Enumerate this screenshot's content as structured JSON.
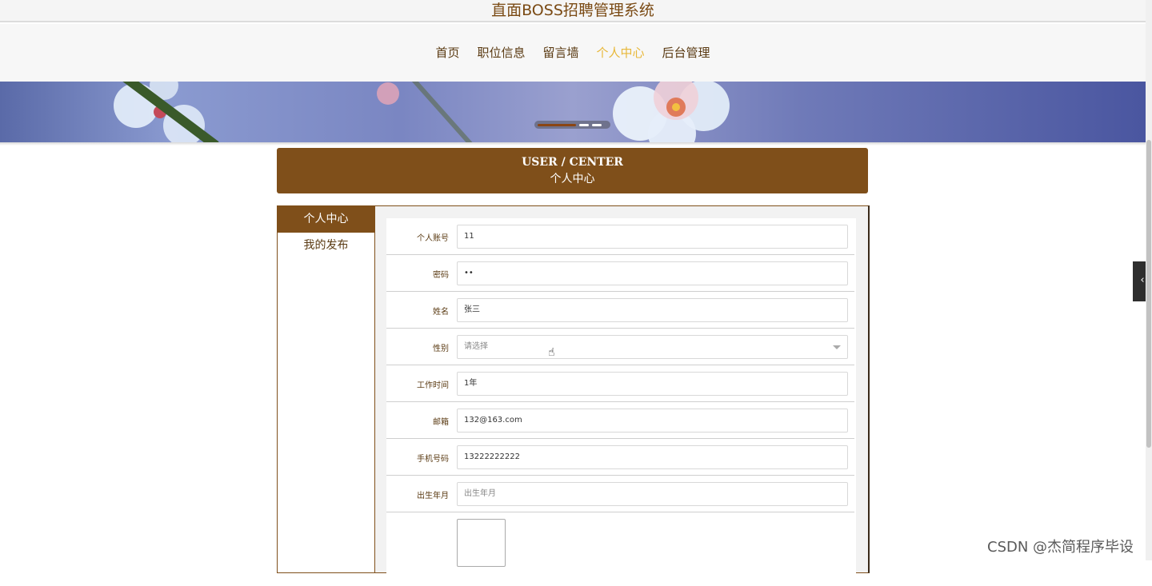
{
  "site": {
    "title": "直面BOSS招聘管理系统"
  },
  "nav": {
    "items": [
      {
        "label": "首页",
        "active": false
      },
      {
        "label": "职位信息",
        "active": false
      },
      {
        "label": "留言墙",
        "active": false
      },
      {
        "label": "个人中心",
        "active": true
      },
      {
        "label": "后台管理",
        "active": false
      }
    ]
  },
  "header": {
    "en": "USER / CENTER",
    "cn": "个人中心"
  },
  "sidebar": {
    "items": [
      {
        "label": "个人中心",
        "active": true
      },
      {
        "label": "我的发布",
        "active": false
      }
    ]
  },
  "form": {
    "account": {
      "label": "个人账号",
      "value": "11"
    },
    "password": {
      "label": "密码",
      "value": "••"
    },
    "name": {
      "label": "姓名",
      "value": "张三"
    },
    "gender": {
      "label": "性别",
      "placeholder": "请选择"
    },
    "work_time": {
      "label": "工作时间",
      "value": "1年"
    },
    "email": {
      "label": "邮箱",
      "value": "132@163.com"
    },
    "phone": {
      "label": "手机号码",
      "value": "13222222222"
    },
    "birth": {
      "label": "出生年月",
      "placeholder": "出生年月"
    }
  },
  "side_tab": {
    "icon": "chevron-left-icon",
    "glyph": "‹"
  },
  "watermark": "CSDN @杰简程序毕设",
  "colors": {
    "brand": "#7f4f1a",
    "nav_active": "#e8b83a"
  }
}
